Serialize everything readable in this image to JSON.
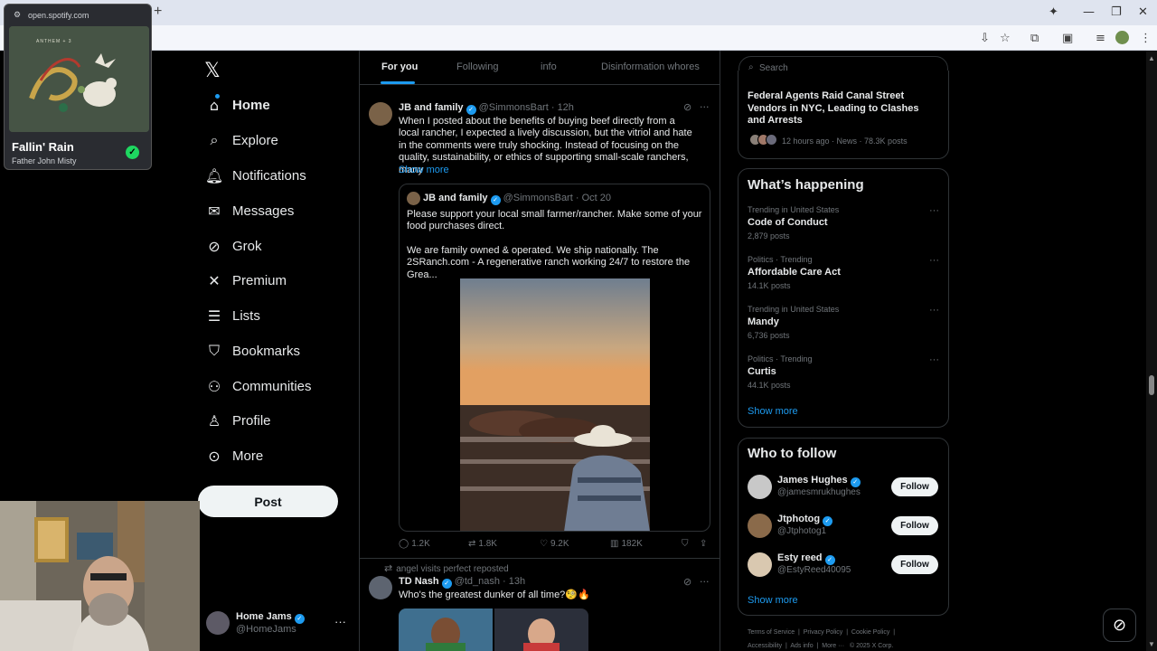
{
  "spotify": {
    "url": "open.spotify.com",
    "album_text": "ANTHEM + 3",
    "song": "Fallin' Rain",
    "artist": "Father John Misty"
  },
  "nav": {
    "items": [
      {
        "label": "Home",
        "icon": "home-icon"
      },
      {
        "label": "Explore",
        "icon": "search-icon"
      },
      {
        "label": "Notifications",
        "icon": "bell-icon"
      },
      {
        "label": "Messages",
        "icon": "envelope-icon"
      },
      {
        "label": "Grok",
        "icon": "grok-icon"
      },
      {
        "label": "Premium",
        "icon": "x-logo-icon"
      },
      {
        "label": "Lists",
        "icon": "list-icon"
      },
      {
        "label": "Bookmarks",
        "icon": "bookmark-icon"
      },
      {
        "label": "Communities",
        "icon": "people-icon"
      },
      {
        "label": "Profile",
        "icon": "person-icon"
      },
      {
        "label": "More",
        "icon": "more-circle-icon"
      }
    ],
    "post_label": "Post",
    "account": {
      "name": "Home Jams",
      "handle": "@HomeJams"
    }
  },
  "tabs": [
    "For you",
    "Following",
    "info",
    "Disinformation whores"
  ],
  "tweet1": {
    "name": "JB and family",
    "handle": "@SimmonsBart",
    "time": "12h",
    "text": "When I posted about the benefits of buying beef directly from a local rancher, I expected a lively discussion, but the vitriol and hate in the comments were truly shocking. Instead of focusing on the quality, sustainability, or ethics of supporting small-scale ranchers, many",
    "show_more": "Show more",
    "quote": {
      "name": "JB and family",
      "handle": "@SimmonsBart",
      "time": "Oct 20",
      "text1": "Please support your local small farmer/rancher.  Make some of your food purchases direct.",
      "text2": "We are family owned & operated.  We ship nationally.  The 2SRanch.com - A regenerative ranch working 24/7 to restore the Grea..."
    },
    "stats": {
      "replies": "1.2K",
      "reposts": "1.8K",
      "likes": "9.2K",
      "views": "182K"
    }
  },
  "tweet2": {
    "repost_note": "angel visits perfect reposted",
    "name": "TD Nash",
    "handle": "@td_nash",
    "time": "13h",
    "text": "Who's the greatest dunker of all time?🧐🔥"
  },
  "right": {
    "search_placeholder": "Search",
    "news": {
      "title": "Federal Agents Raid Canal Street Vendors in NYC, Leading to Clashes and Arrests",
      "meta": "12 hours ago · News · 78.3K posts"
    },
    "whats_happening": {
      "heading": "What’s happening",
      "trends": [
        {
          "context": "Trending in United States",
          "title": "Code of Conduct",
          "count": "2,879 posts"
        },
        {
          "context": "Politics · Trending",
          "title": "Affordable Care Act",
          "count": "14.1K posts"
        },
        {
          "context": "Trending in United States",
          "title": "Mandy",
          "count": "6,736 posts"
        },
        {
          "context": "Politics · Trending",
          "title": "Curtis",
          "count": "44.1K posts"
        }
      ],
      "show_more": "Show more"
    },
    "who_to_follow": {
      "heading": "Who to follow",
      "users": [
        {
          "name": "James Hughes",
          "handle": "@jamesmrukhughes",
          "button": "Follow"
        },
        {
          "name": "Jtphotog",
          "handle": "@Jtphotog1",
          "button": "Follow"
        },
        {
          "name": "Esty reed",
          "handle": "@EstyReed40095",
          "button": "Follow"
        }
      ],
      "show_more": "Show more"
    },
    "footer": {
      "line1": [
        "Terms of Service",
        "Privacy Policy",
        "Cookie Policy"
      ],
      "line2": [
        "Accessibility",
        "Ads info",
        "More ···",
        "© 2025 X Corp."
      ]
    }
  },
  "colors": {
    "accent": "#1d9bf0",
    "background": "#000000",
    "text": "#e7e9ea",
    "muted": "#71767b",
    "spotify_green": "#1ed760"
  }
}
